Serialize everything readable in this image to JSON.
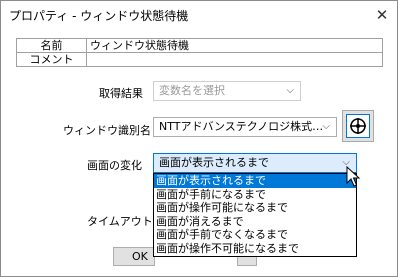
{
  "window": {
    "title": "プロパティ - ウィンドウ状態待機",
    "close_glyph": "✕"
  },
  "info": {
    "rows": [
      {
        "key": "名前",
        "value": "ウィンドウ状態待機"
      },
      {
        "key": "コメント",
        "value": ""
      }
    ]
  },
  "fields": {
    "result_label": "取得結果",
    "result_placeholder": "変数名を選択",
    "window_id_label": "ウィンドウ識別名",
    "window_id_value": "NTTアドバンステクノロジ株式…",
    "change_label": "画面の変化",
    "change_value": "画面が表示されるまで",
    "timeout_label": "タイムアウト"
  },
  "dropdown": {
    "options": [
      "画面が表示されるまで",
      "画面が手前になるまで",
      "画面が操作可能になるまで",
      "画面が消えるまで",
      "画面が手前でなくなるまで",
      "画面が操作不可能になるまで"
    ],
    "selected_index": 0
  },
  "buttons": {
    "ok": "OK"
  },
  "icons": {
    "arrow": "⌵"
  }
}
